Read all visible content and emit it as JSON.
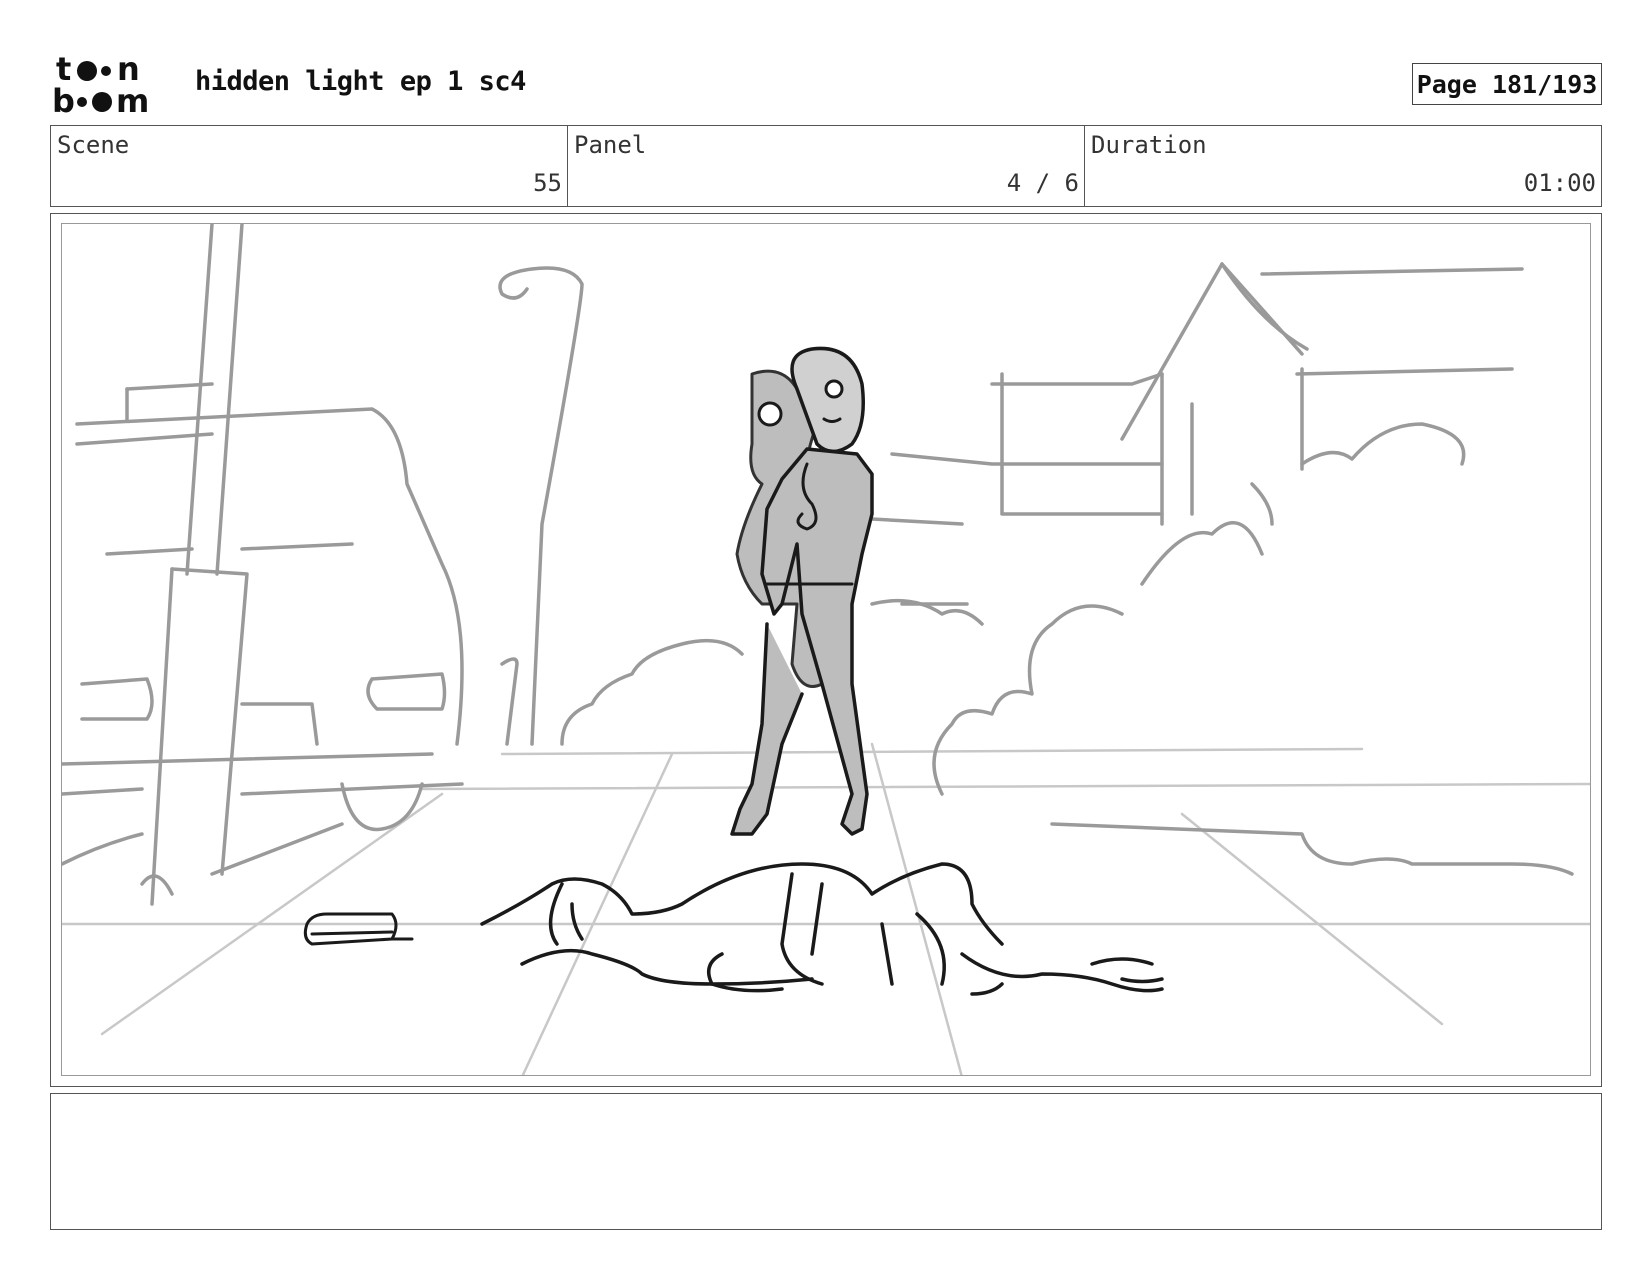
{
  "header": {
    "logo_text_line1": "toon",
    "logo_text_line2": "boom",
    "title": "hidden light ep 1 sc4",
    "page_label": "Page 181/193"
  },
  "info": {
    "scene_label": "Scene",
    "scene_value": "55",
    "panel_label": "Panel",
    "panel_value": "4 / 6",
    "duration_label": "Duration",
    "duration_value": "01:00"
  },
  "notes": {
    "text": ""
  },
  "colors": {
    "sketch_line": "#999999",
    "ink_line": "#1a1a1a",
    "character_fill": "#bdbdbd"
  }
}
